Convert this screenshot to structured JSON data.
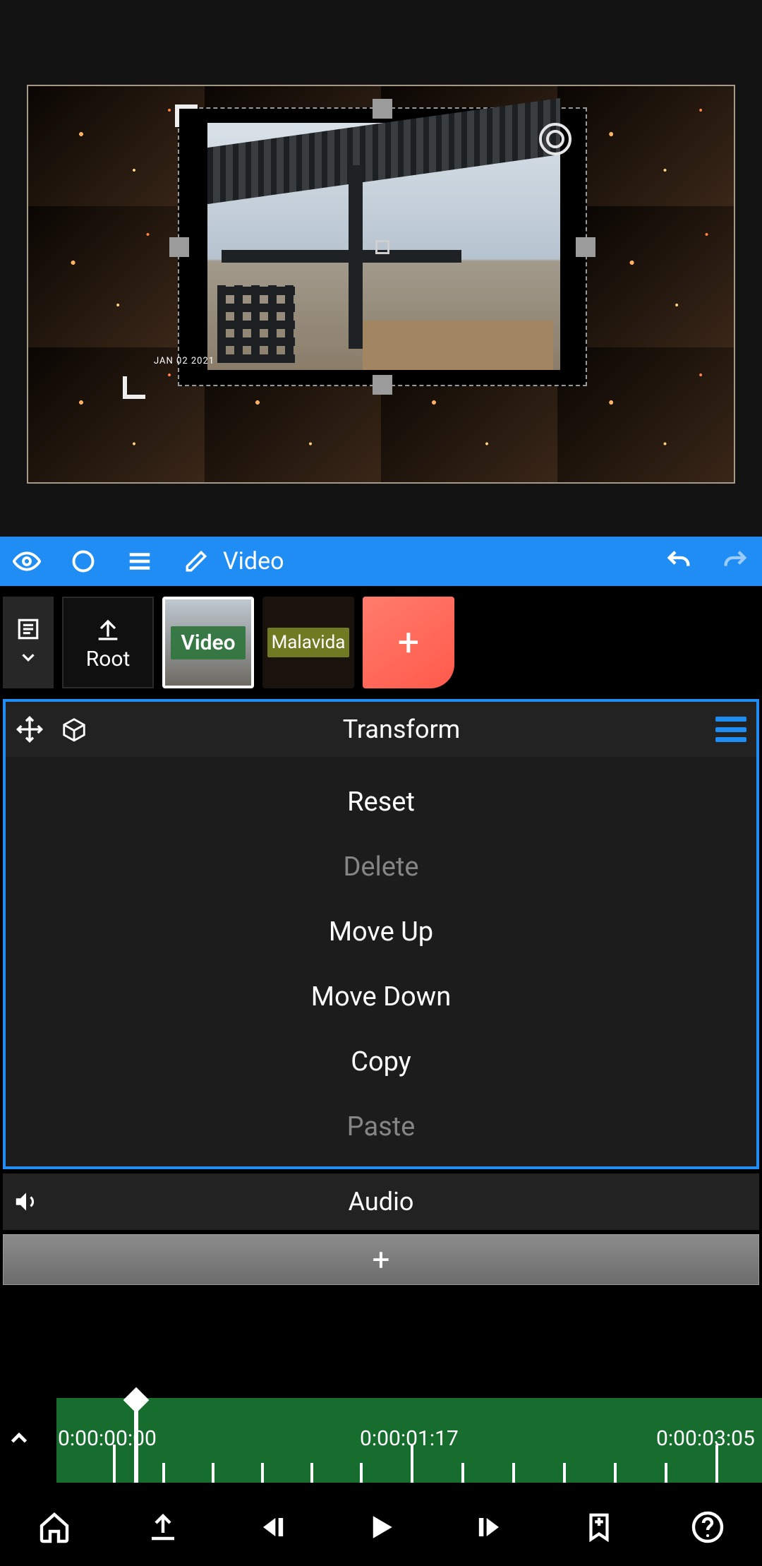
{
  "toolbar": {
    "edit_label": "Video"
  },
  "shelf": {
    "root_label": "Root",
    "items": [
      {
        "label": "Video"
      },
      {
        "label": "Malavida"
      }
    ]
  },
  "transform_panel": {
    "title": "Transform",
    "items": [
      {
        "label": "Reset",
        "disabled": false
      },
      {
        "label": "Delete",
        "disabled": true
      },
      {
        "label": "Move Up",
        "disabled": false
      },
      {
        "label": "Move Down",
        "disabled": false
      },
      {
        "label": "Copy",
        "disabled": false
      },
      {
        "label": "Paste",
        "disabled": true
      }
    ]
  },
  "audio_bar": {
    "title": "Audio"
  },
  "preview": {
    "watermark": "JAN 02 2021"
  },
  "timeline": {
    "times": [
      "0:00:00:00",
      "0:00:01:17",
      "0:00:03:05"
    ]
  }
}
